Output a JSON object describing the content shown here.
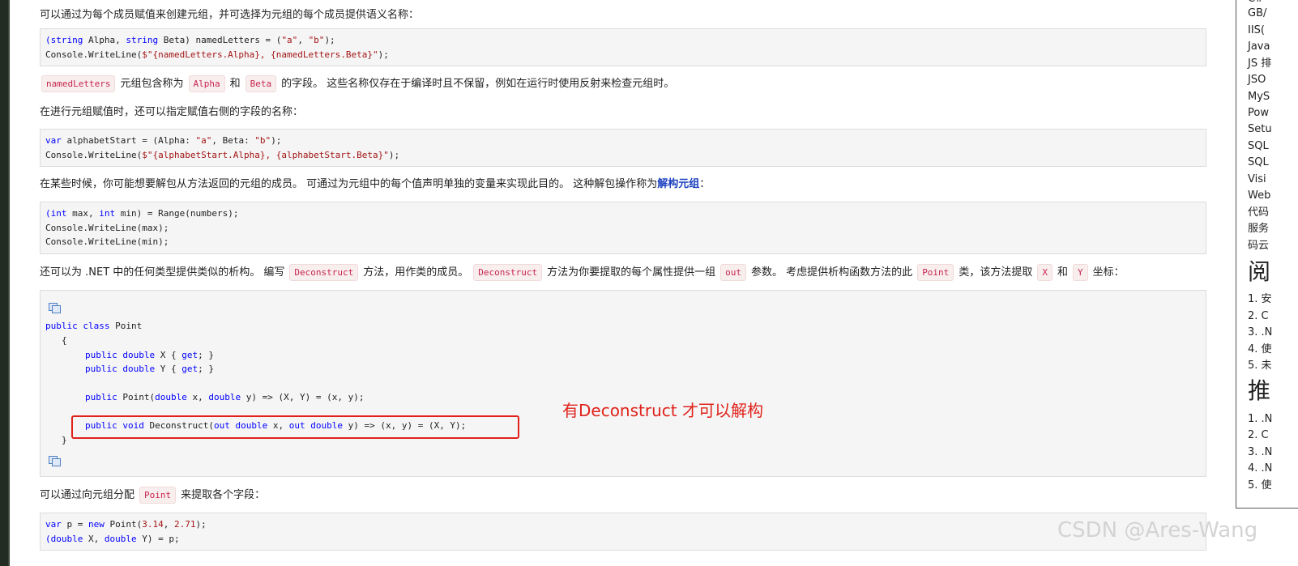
{
  "paragraphs": {
    "p1": "可以通过为每个成员赋值来创建元组，并可选择为元组的每个成员提供语义名称：",
    "p2_code1": "namedLetters",
    "p2_a": "元组包含称为",
    "p2_code2": "Alpha",
    "p2_b": "和",
    "p2_code3": "Beta",
    "p2_c": "的字段。 这些名称仅存在于编译时且不保留，例如在运行时使用反射来检查元组时。",
    "p3": "在进行元组赋值时，还可以指定赋值右侧的字段的名称：",
    "p4_a": "在某些时候，你可能想要解包从方法返回的元组的成员。 可通过为元组中的每个值声明单独的变量来实现此目的。 这种解包操作称为",
    "p4_link": "解构元组",
    "p4_b": "：",
    "p5_a": "还可以为 .NET 中的任何类型提供类似的析构。 编写",
    "p5_code1": "Deconstruct",
    "p5_b": "方法，用作类的成员。",
    "p5_code2": "Deconstruct",
    "p5_c": "方法为你要提取的每个属性提供一组",
    "p5_code3": "out",
    "p5_d": "参数。 考虑提供析构函数方法的此",
    "p5_code4": "Point",
    "p5_e": "类，该方法提取",
    "p5_code5": "X",
    "p5_f": "和",
    "p5_code6": "Y",
    "p5_g": "坐标：",
    "p6_a": "可以通过向元组分配",
    "p6_code": "Point",
    "p6_b": "来提取各个字段："
  },
  "code_blocks": {
    "b1": {
      "l1": {
        "t1": "(",
        "k1": "string",
        "t2": " Alpha, ",
        "k2": "string",
        "t3": " Beta) namedLetters = (",
        "s1": "\"a\"",
        "t4": ", ",
        "s2": "\"b\"",
        "t5": ");"
      },
      "l2": {
        "t1": "Console.WriteLine(",
        "s1": "$\"",
        "t2": "{namedLetters.Alpha}",
        "s2": ", ",
        "t3": "{namedLetters.Beta}",
        "s3": "\"",
        "t4": ");"
      }
    },
    "b2": {
      "l1": {
        "k1": "var",
        "t1": " alphabetStart = (Alpha: ",
        "s1": "\"a\"",
        "t2": ", Beta: ",
        "s2": "\"b\"",
        "t3": ");"
      },
      "l2": {
        "t1": "Console.WriteLine(",
        "s1": "$\"",
        "t2": "{alphabetStart.Alpha}",
        "s2": ", ",
        "t3": "{alphabetStart.Beta}",
        "s3": "\"",
        "t4": ");"
      }
    },
    "b3": {
      "l1": {
        "t1": "(",
        "k1": "int",
        "t2": " max, ",
        "k2": "int",
        "t3": " min) = Range(numbers);"
      },
      "l2": "Console.WriteLine(max);",
      "l3": "Console.WriteLine(min);"
    },
    "b4": {
      "l1": {
        "k1": "public",
        "k2": "class",
        "t1": "Point"
      },
      "l2": "{",
      "l3": {
        "k1": "public",
        "k2": "double",
        "t1": "X {",
        "k3": "get",
        "t2": "; }"
      },
      "l4": {
        "k1": "public",
        "k2": "double",
        "t1": "Y {",
        "k3": "get",
        "t2": "; }"
      },
      "l5": {
        "k1": "public",
        "t1": "Point(",
        "k2": "double",
        "t2": " x, ",
        "k3": "double",
        "t3": " y) => (X, Y) = (x, y);"
      },
      "l6": {
        "k1": "public",
        "k2": "void",
        "t1": "Deconstruct(",
        "k3": "out",
        "k4": "double",
        "t2": " x, ",
        "k5": "out",
        "k6": "double",
        "t3": " y) => (x, y) = (X, Y);"
      },
      "l7": "}"
    },
    "b5": {
      "l1": {
        "k1": "var",
        "t1": " p = ",
        "k2": "new",
        "t2": " Point(",
        "n1": "3.14",
        "t3": ", ",
        "n2": "2.71",
        "t4": ");"
      },
      "l2": {
        "t1": "(",
        "k1": "double",
        "t2": " X, ",
        "k2": "double",
        "t3": " Y) = p;"
      }
    }
  },
  "annotation": "有Deconstruct 才可以解构",
  "sidebar": {
    "items": [
      "C#",
      "GB/",
      "IIS(",
      "Java",
      "JS 排",
      "JSO",
      "MyS",
      "Pow",
      "Setu",
      "SQL",
      "SQL",
      "Visi",
      "Web",
      "代码",
      "服务",
      "码云"
    ],
    "heading1": "阅",
    "list1": [
      "1. 安",
      "2. C",
      "3. .N",
      "4. 使",
      "5. 未"
    ],
    "heading2": "推",
    "list2": [
      "1. .N",
      "2. C",
      "3. .N",
      "4. .N",
      "5. 使"
    ]
  },
  "watermark": "CSDN @Ares-Wang",
  "colors": {
    "keyword": "#0000ff",
    "string": "#a31515",
    "number": "#a31515",
    "highlight": "#e0221b",
    "link": "#1a3fbf"
  },
  "icons": {
    "copy": "copy-code-icon"
  }
}
